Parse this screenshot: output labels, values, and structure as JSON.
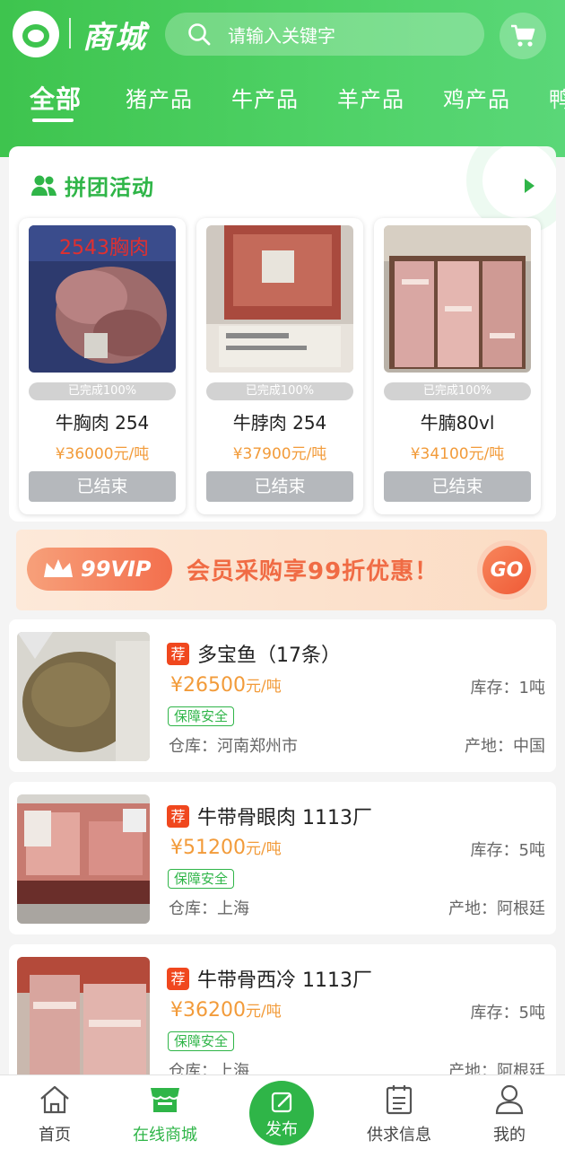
{
  "header": {
    "brand": "商城",
    "search_placeholder": "请输入关键字",
    "tabs": [
      "全部",
      "猪产品",
      "牛产品",
      "羊产品",
      "鸡产品",
      "鸭"
    ]
  },
  "group_buy": {
    "title": "拼团活动",
    "products": [
      {
        "name": "牛胸肉 254",
        "price": "¥36000元/吨",
        "progress": "已完成100%",
        "progress_value": 100,
        "button": "已结束",
        "image_label": "2543胸肉"
      },
      {
        "name": "牛脖肉 254",
        "price": "¥37900元/吨",
        "progress": "已完成100%",
        "progress_value": 100,
        "button": "已结束"
      },
      {
        "name": "牛腩80vl",
        "price": "¥34100元/吨",
        "progress": "已完成100%",
        "progress_value": 100,
        "button": "已结束"
      }
    ]
  },
  "banner": {
    "vip": "99VIP",
    "text": "会员采购享99折优惠！",
    "go": "GO"
  },
  "list": [
    {
      "badge": "荐",
      "name": "多宝鱼（17条）",
      "price": "¥26500",
      "unit": "元/吨",
      "stock": "库存：1吨",
      "tag": "保障安全",
      "warehouse": "仓库：河南郑州市",
      "origin": "产地：中国"
    },
    {
      "badge": "荐",
      "name": "牛带骨眼肉 1113厂",
      "price": "¥51200",
      "unit": "元/吨",
      "stock": "库存：5吨",
      "tag": "保障安全",
      "warehouse": "仓库：上海",
      "origin": "产地：阿根廷"
    },
    {
      "badge": "荐",
      "name": "牛带骨西冷 1113厂",
      "price": "¥36200",
      "unit": "元/吨",
      "stock": "库存：5吨",
      "tag": "保障安全",
      "warehouse": "仓库：上海",
      "origin": "产地：阿根廷"
    }
  ],
  "nav": {
    "home": "首页",
    "mall": "在线商城",
    "publish": "发布",
    "supply": "供求信息",
    "mine": "我的"
  },
  "colors": {
    "brand_green": "#2fb548",
    "price_orange": "#f29b3a",
    "badge_red": "#f0471e"
  }
}
